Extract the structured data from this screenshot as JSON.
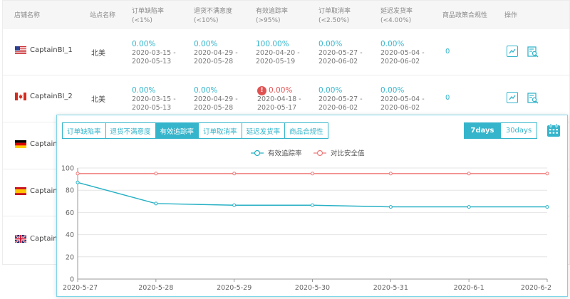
{
  "table": {
    "headers": [
      {
        "line1": "店铺名称",
        "line2": ""
      },
      {
        "line1": "站点名称",
        "line2": ""
      },
      {
        "line1": "订单缺陷率",
        "line2": "(<1%)"
      },
      {
        "line1": "退货不满意度",
        "line2": "(<10%)"
      },
      {
        "line1": "有效追踪率",
        "line2": "(>95%)"
      },
      {
        "line1": "订单取消率",
        "line2": "(<2.50%)"
      },
      {
        "line1": "延迟发货率",
        "line2": "(<4.00%)"
      },
      {
        "line1": "商品政策合规性",
        "line2": ""
      },
      {
        "line1": "操作",
        "line2": ""
      }
    ],
    "rows": [
      {
        "store": "CaptainBI_1",
        "site": "北美",
        "metrics": [
          {
            "value": "0.00%",
            "date_from": "2020-03-15 -",
            "date_to": "2020-05-13"
          },
          {
            "value": "0.00%",
            "date_from": "2020-04-29 -",
            "date_to": "2020-05-28"
          },
          {
            "value": "100.00%",
            "date_from": "2020-04-20 -",
            "date_to": "2020-05-19"
          },
          {
            "value": "0.00%",
            "date_from": "2020-05-27 -",
            "date_to": "2020-06-02"
          },
          {
            "value": "0.00%",
            "date_from": "2020-05-04 -",
            "date_to": "2020-06-02"
          }
        ],
        "policy": "0"
      },
      {
        "store": "CaptainBI_2",
        "site": "北美",
        "metrics": [
          {
            "value": "0.00%",
            "date_from": "2020-03-15 -",
            "date_to": "2020-05-13"
          },
          {
            "value": "0.00%",
            "date_from": "2020-04-29 -",
            "date_to": "2020-05-28"
          },
          {
            "value": "0.00%",
            "date_from": "2020-04-18 -",
            "date_to": "2020-05-17"
          },
          {
            "value": "0.00%",
            "date_from": "2020-05-27 -",
            "date_to": "2020-06-02"
          },
          {
            "value": "0.00%",
            "date_from": "2020-05-04 -",
            "date_to": "2020-06-02"
          }
        ],
        "policy": "0"
      },
      {
        "store": "CaptainB"
      },
      {
        "store": "CaptainB"
      },
      {
        "store": "CaptainB"
      }
    ]
  },
  "panel": {
    "tabs": [
      "订单缺陷率",
      "退货不满意度",
      "有效追踪率",
      "订单取消率",
      "延迟发货率",
      "商品合规性"
    ],
    "active_tab": 2,
    "range_buttons": [
      "7days",
      "30days"
    ],
    "active_range": 0
  },
  "chart_data": {
    "type": "line",
    "categories": [
      "2020-5-27",
      "2020-5-28",
      "2020-5-29",
      "2020-5-30",
      "2020-5-31",
      "2020-6-1",
      "2020-6-2"
    ],
    "series": [
      {
        "name": "有效追踪率",
        "values": [
          87,
          68,
          66.5,
          66.5,
          65,
          65,
          65
        ],
        "color": "#26b0c4"
      },
      {
        "name": "对比安全值",
        "values": [
          95,
          95,
          95,
          95,
          95,
          95,
          95
        ],
        "color": "#ef7a7a"
      }
    ],
    "ylim": [
      0,
      100
    ],
    "yticks": [
      0,
      20,
      40,
      60,
      80,
      100
    ],
    "grid": true,
    "legend": "top-center"
  },
  "colors": {
    "accent": "#35b5cc",
    "alert": "#e05252"
  }
}
